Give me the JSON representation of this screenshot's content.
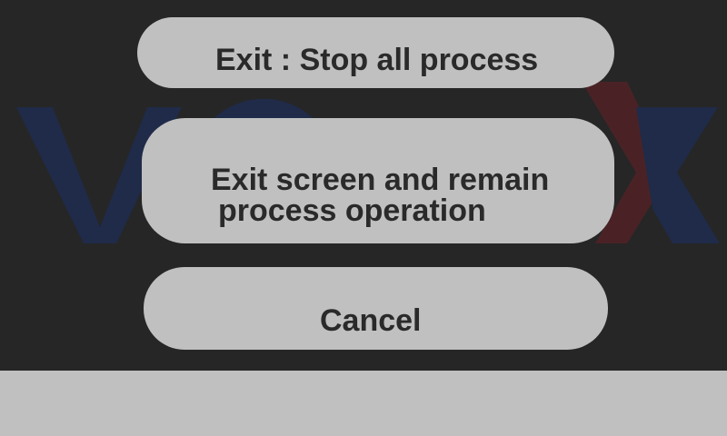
{
  "dialog": {
    "stop_button": "Exit : Stop all process",
    "remain_button_line1": "Exit screen and remain",
    "remain_button_line2": "process operation",
    "cancel_button": "Cancel"
  },
  "background_logo": {
    "icon": "vortex-logo-watermark",
    "colors": {
      "blue": "#1f2b48",
      "red": "#4a2226"
    }
  },
  "colors": {
    "overlay": "#262626",
    "button": "#c0c0c0",
    "button_text": "#2a2a2a",
    "bottom_bar": "#c0c0c0"
  }
}
